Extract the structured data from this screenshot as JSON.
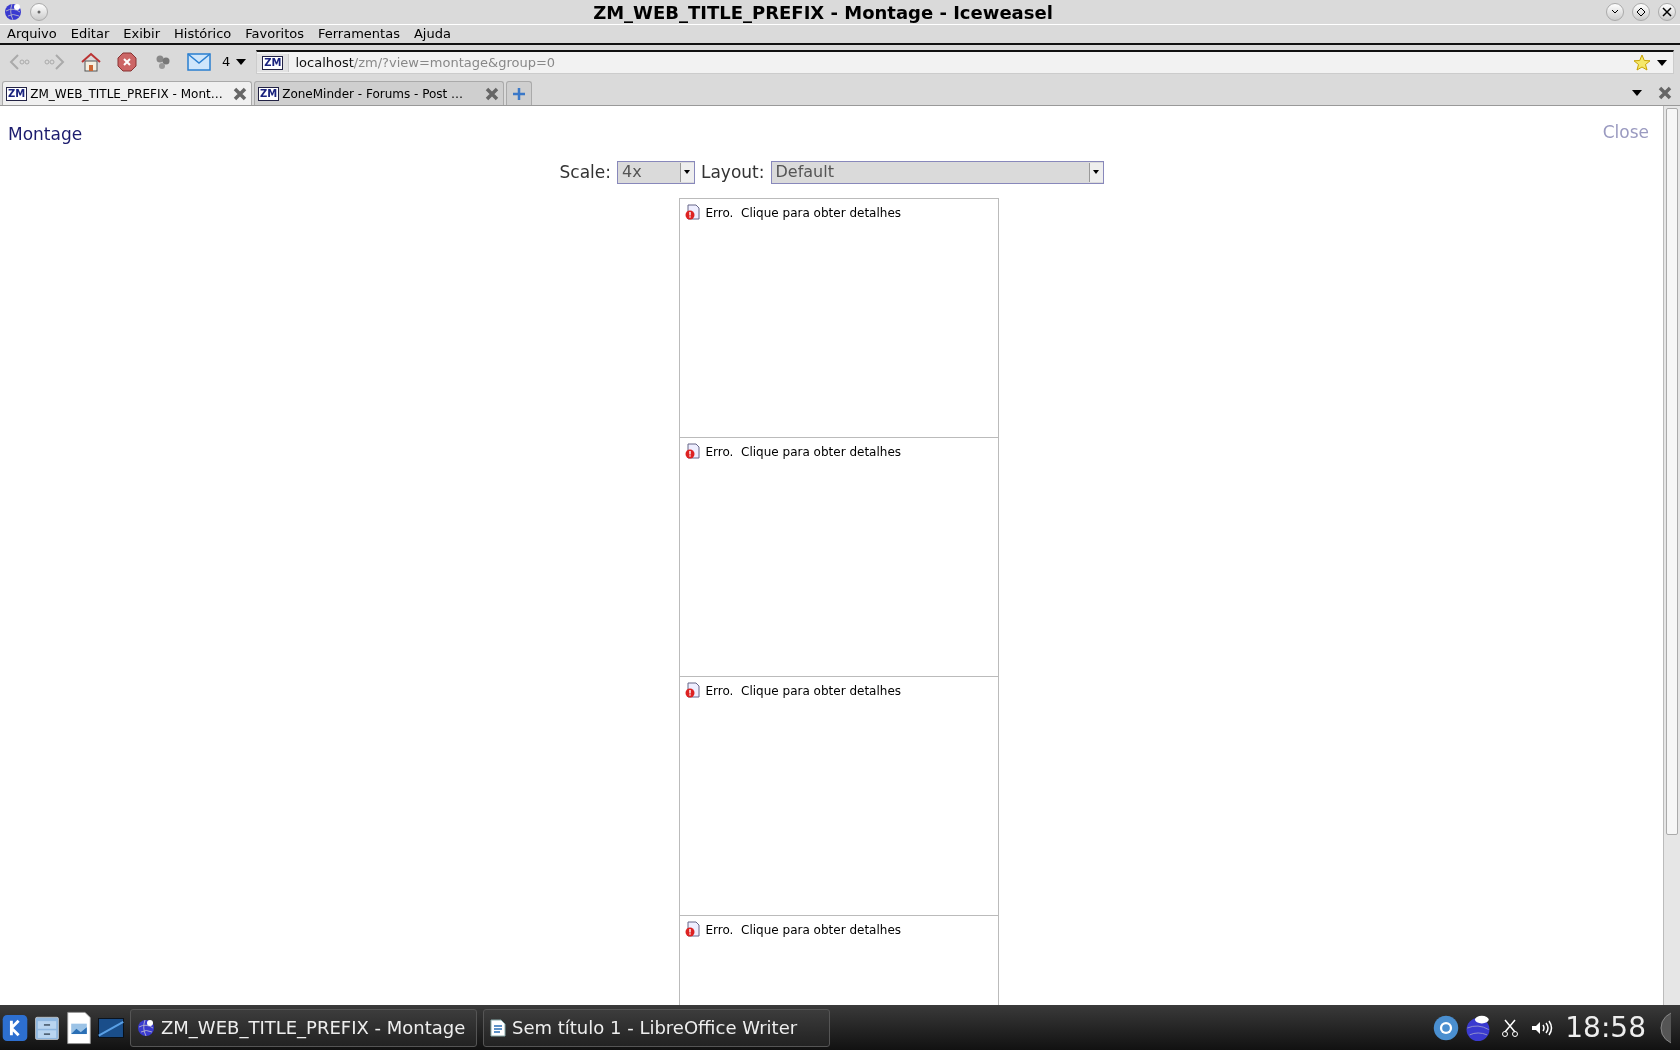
{
  "window": {
    "title": "ZM_WEB_TITLE_PREFIX - Montage - Iceweasel"
  },
  "menu": [
    {
      "label": "Arquivo"
    },
    {
      "label": "Editar"
    },
    {
      "label": "Exibir"
    },
    {
      "label": "Histórico"
    },
    {
      "label": "Favoritos"
    },
    {
      "label": "Ferramentas"
    },
    {
      "label": "Ajuda"
    }
  ],
  "toolbar": {
    "mail_count": "4",
    "url": {
      "favicon": "ZM",
      "host": "localhost",
      "path": "/zm/?view=montage&group=0"
    }
  },
  "tabs": [
    {
      "favicon": "ZM",
      "label": "ZM_WEB_TITLE_PREFIX - Mont…",
      "selected": true
    },
    {
      "favicon": "ZM",
      "label": "ZoneMinder - Forums - Post …",
      "selected": false
    }
  ],
  "page": {
    "title": "Montage",
    "close": "Close",
    "scale": {
      "label": "Scale:",
      "value": "4x"
    },
    "layout": {
      "label": "Layout:",
      "value": "Default"
    },
    "monitors": [
      {
        "status": "Erro.",
        "message": "Clique para obter detalhes"
      },
      {
        "status": "Erro.",
        "message": "Clique para obter detalhes"
      },
      {
        "status": "Erro.",
        "message": "Clique para obter detalhes"
      },
      {
        "status": "Erro.",
        "message": "Clique para obter detalhes"
      }
    ]
  },
  "taskbar": {
    "tasks": [
      {
        "label": "ZM_WEB_TITLE_PREFIX - Montage",
        "kind": "browser"
      },
      {
        "label": "Sem título 1 - LibreOffice Writer",
        "kind": "document"
      }
    ],
    "clock": "18:58"
  }
}
